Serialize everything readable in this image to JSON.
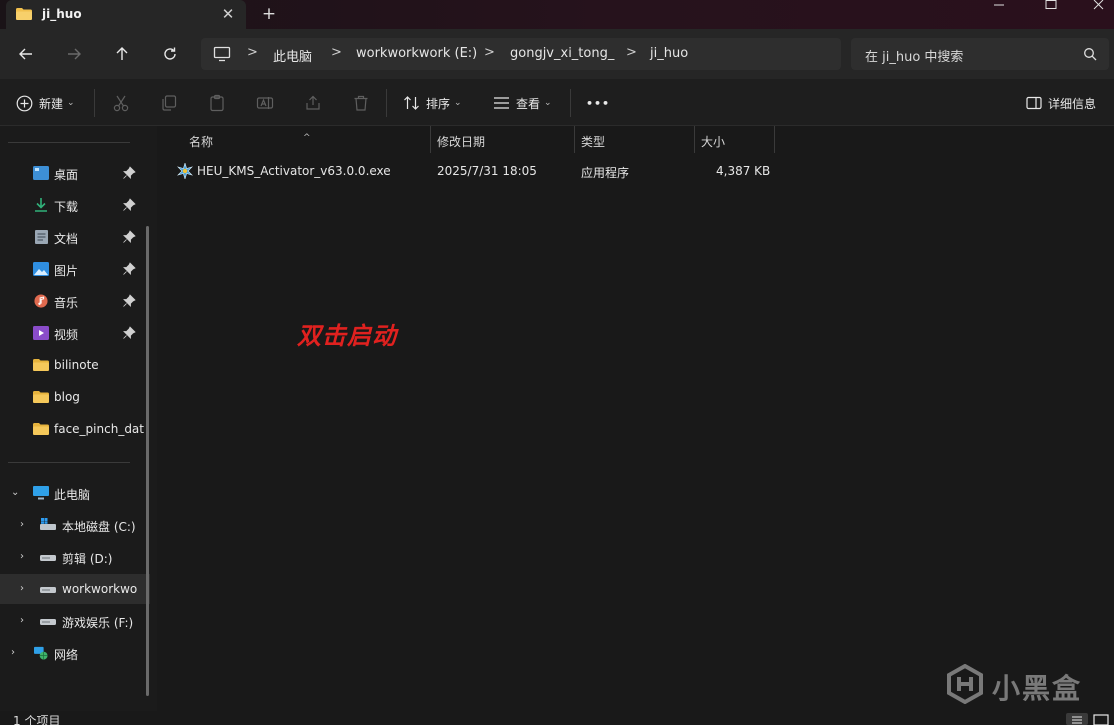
{
  "tab": {
    "title": "ji_huo",
    "close_glyph": "✕",
    "new_tab_glyph": "+"
  },
  "window_controls": {
    "minimize": "minimize-icon",
    "maximize": "maximize-icon",
    "close": "close-icon"
  },
  "address": {
    "crumbs": [
      "此电脑",
      "workworkwork (E:)",
      "gongjv_xi_tong_",
      "ji_huo"
    ],
    "separator": ">"
  },
  "search": {
    "placeholder": "在 ji_huo 中搜索"
  },
  "commandbar": {
    "new_label": "新建",
    "sort_label": "排序",
    "view_label": "查看",
    "more_glyph": "•••",
    "details_label": "详细信息"
  },
  "sidebar": {
    "quick_access": [
      {
        "label": "桌面",
        "icon": "desktop-icon",
        "pinned": true
      },
      {
        "label": "下载",
        "icon": "download-icon",
        "pinned": true
      },
      {
        "label": "文档",
        "icon": "document-icon",
        "pinned": true
      },
      {
        "label": "图片",
        "icon": "pictures-icon",
        "pinned": true
      },
      {
        "label": "音乐",
        "icon": "music-icon",
        "pinned": true
      },
      {
        "label": "视频",
        "icon": "video-icon",
        "pinned": true
      },
      {
        "label": "bilinote",
        "icon": "folder-icon",
        "pinned": false
      },
      {
        "label": "blog",
        "icon": "folder-icon",
        "pinned": false
      },
      {
        "label": "face_pinch_dat",
        "icon": "folder-icon",
        "pinned": false
      }
    ],
    "this_pc": {
      "label": "此电脑",
      "expanded": true
    },
    "drives": [
      {
        "label": "本地磁盘 (C:)",
        "icon": "system-drive-icon"
      },
      {
        "label": "剪辑 (D:)",
        "icon": "drive-icon"
      },
      {
        "label": "workworkwo",
        "icon": "drive-icon",
        "selected": true
      },
      {
        "label": "游戏娱乐 (F:)",
        "icon": "drive-icon"
      }
    ],
    "network": {
      "label": "网络"
    }
  },
  "columns": {
    "name": "名称",
    "modified": "修改日期",
    "type": "类型",
    "size": "大小"
  },
  "files": [
    {
      "name": "HEU_KMS_Activator_v63.0.0.exe",
      "modified": "2025/7/31 18:05",
      "type": "应用程序",
      "size": "4,387 KB"
    }
  ],
  "annotation": "双击启动",
  "status": {
    "item_count": "1 个项目"
  },
  "watermark": {
    "text": "小黑盒"
  },
  "colors": {
    "accent": "#4cc2ff",
    "folder": "#f2c14e",
    "annotation": "#e0211f"
  }
}
